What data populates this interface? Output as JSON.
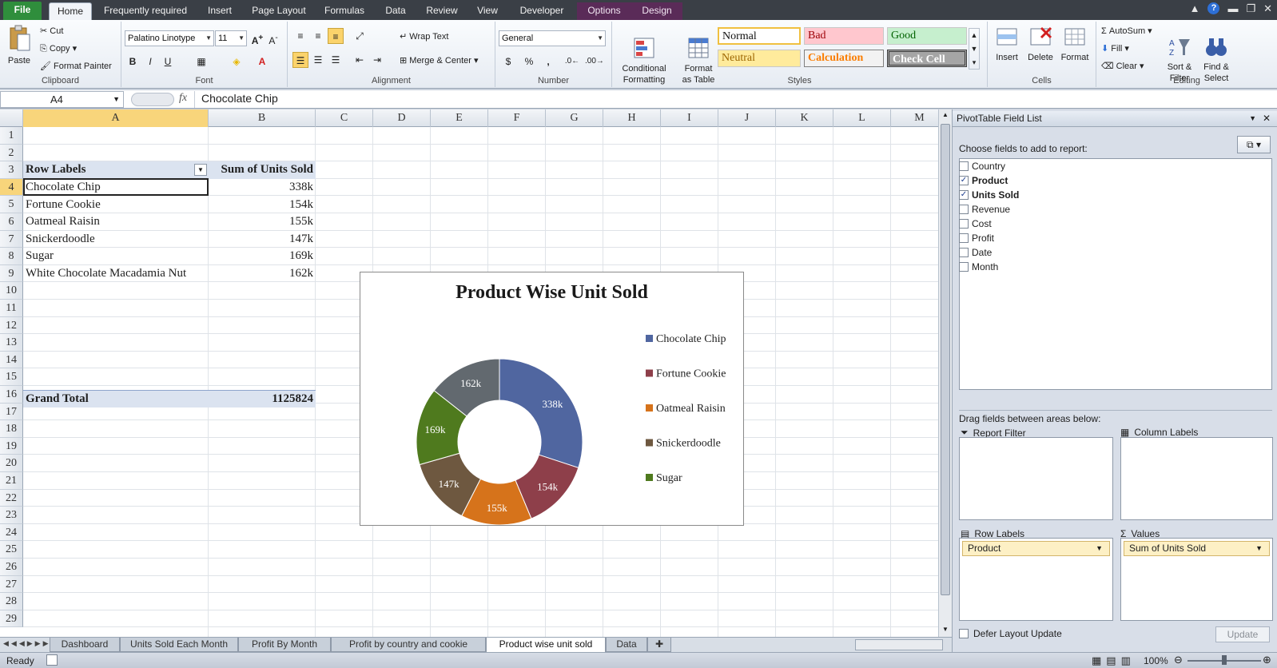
{
  "ribbon_tabs": [
    "File",
    "Home",
    "Frequently required",
    "Insert",
    "Page Layout",
    "Formulas",
    "Data",
    "Review",
    "View",
    "Developer",
    "Options",
    "Design"
  ],
  "clipboard": {
    "paste": "Paste",
    "cut": "Cut",
    "copy": "Copy",
    "format_painter": "Format Painter",
    "label": "Clipboard"
  },
  "font": {
    "name": "Palatino Linotype",
    "size": "11",
    "bold": "B",
    "italic": "I",
    "underline": "U",
    "label": "Font"
  },
  "alignment": {
    "wrap": "Wrap Text",
    "merge": "Merge & Center",
    "label": "Alignment"
  },
  "number": {
    "format": "General",
    "currency": "$",
    "percent": "%",
    "comma": ",",
    "label": "Number"
  },
  "styles": {
    "conditional": "Conditional\nFormatting",
    "format_table": "Format\nas Table",
    "normal": "Normal",
    "bad": "Bad",
    "good": "Good",
    "neutral": "Neutral",
    "calculation": "Calculation",
    "check": "Check Cell",
    "label": "Styles"
  },
  "cells": {
    "insert": "Insert",
    "delete": "Delete",
    "format": "Format",
    "label": "Cells"
  },
  "editing": {
    "autosum": "AutoSum",
    "fill": "Fill",
    "clear": "Clear",
    "sort": "Sort &\nFilter",
    "find": "Find &\nSelect",
    "label": "Editing"
  },
  "formula_bar": {
    "name_box": "A4",
    "fx": "fx",
    "content": "Chocolate Chip"
  },
  "columns": [
    "A",
    "B",
    "C",
    "D",
    "E",
    "F",
    "G",
    "H",
    "I",
    "J",
    "K",
    "L",
    "M"
  ],
  "rows": [
    "1",
    "2",
    "3",
    "4",
    "5",
    "6",
    "7",
    "8",
    "9",
    "10",
    "11",
    "12",
    "13",
    "14",
    "15",
    "16",
    "17",
    "18",
    "19",
    "20",
    "21",
    "22",
    "23",
    "24",
    "25",
    "26",
    "27",
    "28",
    "29"
  ],
  "pivot": {
    "header_label": "Row Labels",
    "header_value": "Sum of Units Sold",
    "rows": [
      {
        "label": "Chocolate Chip",
        "value": "338k"
      },
      {
        "label": "Fortune Cookie",
        "value": "154k"
      },
      {
        "label": "Oatmeal Raisin",
        "value": "155k"
      },
      {
        "label": "Snickerdoodle",
        "value": "147k"
      },
      {
        "label": "Sugar",
        "value": "169k"
      },
      {
        "label": "White Chocolate Macadamia Nut",
        "value": "162k"
      }
    ],
    "total_label": "Grand Total",
    "total_value": "1125824"
  },
  "chart_data": {
    "type": "pie",
    "variant": "doughnut",
    "title": "Product Wise Unit Sold",
    "categories": [
      "Chocolate Chip",
      "Fortune Cookie",
      "Oatmeal Raisin",
      "Snickerdoodle",
      "Sugar",
      "White Chocolate Macadamia Nut"
    ],
    "values": [
      338,
      154,
      155,
      147,
      169,
      162
    ],
    "data_labels": [
      "338k",
      "154k",
      "155k",
      "147k",
      "169k",
      "162k"
    ],
    "colors": [
      "#5066a0",
      "#8e3f4a",
      "#d6731b",
      "#6e5840",
      "#4f7a1e",
      "#62696f"
    ],
    "legend_entries": [
      "Chocolate Chip",
      "Fortune Cookie",
      "Oatmeal Raisin",
      "Snickerdoodle",
      "Sugar"
    ],
    "legend_position": "right"
  },
  "sheet_tabs": [
    "Dashboard",
    "Units Sold Each Month",
    "Profit By Month",
    "Profit by country and cookie",
    "Product wise unit sold",
    "Data"
  ],
  "active_sheet": "Product wise unit sold",
  "status": {
    "ready": "Ready",
    "zoom": "100%"
  },
  "field_list": {
    "title": "PivotTable Field List",
    "choose": "Choose fields to add to report:",
    "fields": [
      {
        "name": "Country",
        "checked": false
      },
      {
        "name": "Product",
        "checked": true
      },
      {
        "name": "Units Sold",
        "checked": true
      },
      {
        "name": "Revenue",
        "checked": false
      },
      {
        "name": "Cost",
        "checked": false
      },
      {
        "name": "Profit",
        "checked": false
      },
      {
        "name": "Date",
        "checked": false
      },
      {
        "name": "Month",
        "checked": false
      }
    ],
    "drag": "Drag fields between areas below:",
    "report_filter": "Report Filter",
    "column_labels": "Column Labels",
    "row_labels": "Row Labels",
    "values": "Values",
    "row_chip": "Product",
    "value_chip": "Sum of Units Sold",
    "defer": "Defer Layout Update",
    "update": "Update"
  }
}
